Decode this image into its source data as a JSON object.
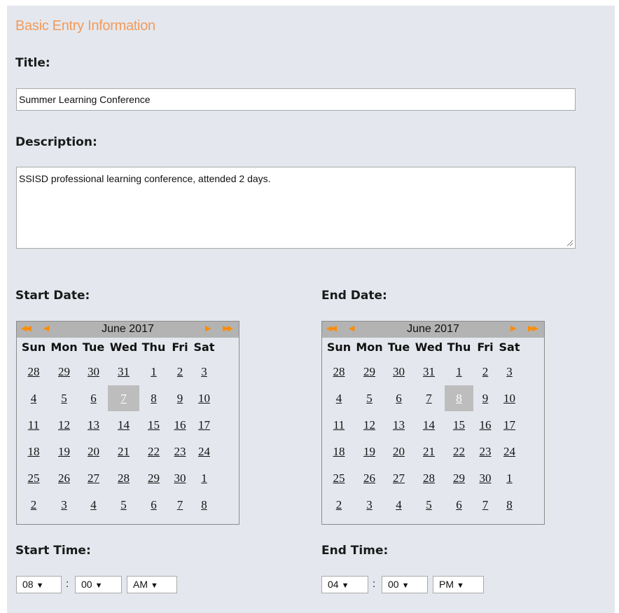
{
  "section_title": "Basic Entry Information",
  "title_label": "Title:",
  "title_value": "Summer Learning Conference",
  "description_label": "Description:",
  "description_value": "SSISD professional learning conference, attended 2 days.",
  "start_date_label": "Start Date:",
  "end_date_label": "End Date:",
  "start_time_label": "Start Time:",
  "end_time_label": "End Time:",
  "calendar": {
    "month_label": "June 2017",
    "nav_prev_year": "◀◀",
    "nav_prev_month": "◀",
    "nav_next_month": "▶",
    "nav_next_year": "▶▶",
    "weekdays": [
      "Sun",
      "Mon",
      "Tue",
      "Wed",
      "Thu",
      "Fri",
      "Sat"
    ],
    "weeks": [
      [
        "28",
        "29",
        "30",
        "31",
        "1",
        "2",
        "3"
      ],
      [
        "4",
        "5",
        "6",
        "7",
        "8",
        "9",
        "10"
      ],
      [
        "11",
        "12",
        "13",
        "14",
        "15",
        "16",
        "17"
      ],
      [
        "18",
        "19",
        "20",
        "21",
        "22",
        "23",
        "24"
      ],
      [
        "25",
        "26",
        "27",
        "28",
        "29",
        "30",
        "1"
      ],
      [
        "2",
        "3",
        "4",
        "5",
        "6",
        "7",
        "8"
      ]
    ]
  },
  "start_calendar_selected_day": "7",
  "end_calendar_selected_day": "8",
  "start_time": {
    "hour": "08",
    "minute": "00",
    "ampm": "AM",
    "separator": ":"
  },
  "end_time": {
    "hour": "04",
    "minute": "00",
    "ampm": "PM",
    "separator": ":"
  },
  "caret_icon": "▼",
  "colors": {
    "accent": "#f29a5c",
    "nav_arrows": "#ff8c00",
    "panel_bg": "#e4e8ee",
    "header_bg": "#b3b3b3",
    "selected_bg": "#bdbdbd"
  }
}
